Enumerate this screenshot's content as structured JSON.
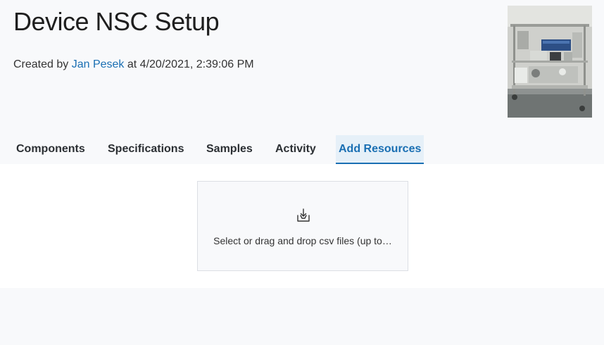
{
  "header": {
    "title": "Device NSC Setup",
    "created_prefix": "Created by",
    "author": "Jan Pesek",
    "created_suffix": "at 4/20/2021, 2:39:06 PM"
  },
  "tabs": [
    {
      "label": "Components",
      "active": false
    },
    {
      "label": "Specifications",
      "active": false
    },
    {
      "label": "Samples",
      "active": false
    },
    {
      "label": "Activity",
      "active": false
    },
    {
      "label": "Add Resources",
      "active": true
    }
  ],
  "dropzone": {
    "text": "Select or drag and drop csv files (up to…",
    "icon": "download-tray-icon"
  },
  "colors": {
    "accent": "#1a6fb3",
    "active_tab_bg": "#e6f0f8",
    "page_bg": "#f8f9fb"
  }
}
